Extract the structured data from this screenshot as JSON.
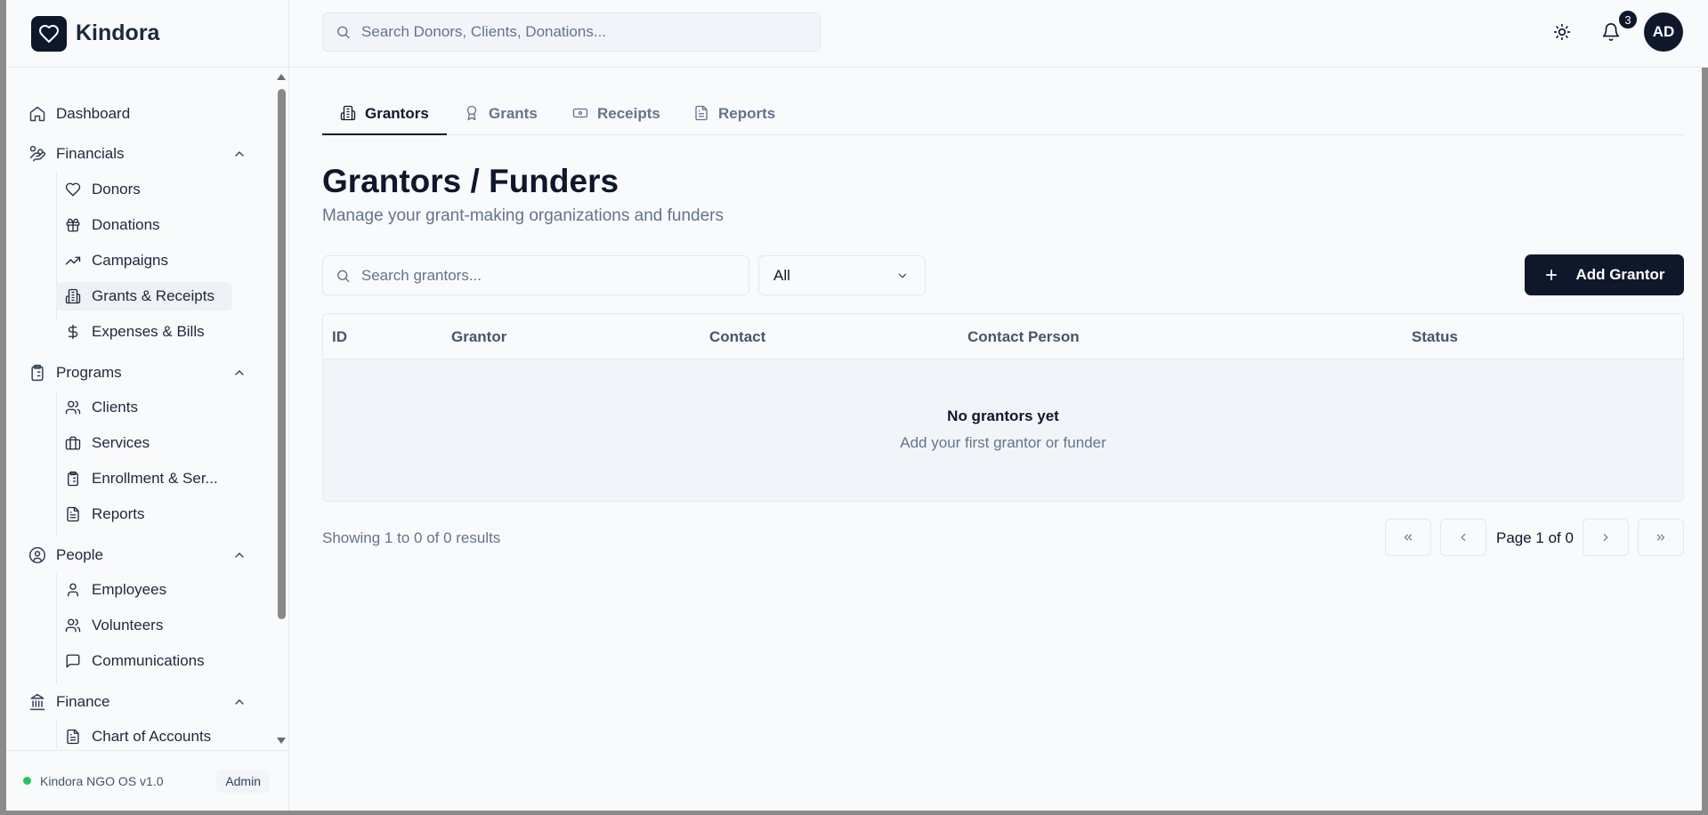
{
  "app": {
    "name": "Kindora"
  },
  "search": {
    "placeholder": "Search Donors, Clients, Donations..."
  },
  "header": {
    "notification_count": "3",
    "avatar_initials": "AD"
  },
  "sidebar": {
    "dashboard": "Dashboard",
    "financials": {
      "label": "Financials",
      "items": [
        "Donors",
        "Donations",
        "Campaigns",
        "Grants & Receipts",
        "Expenses & Bills"
      ]
    },
    "programs": {
      "label": "Programs",
      "items": [
        "Clients",
        "Services",
        "Enrollment & Ser...",
        "Reports"
      ]
    },
    "people": {
      "label": "People",
      "items": [
        "Employees",
        "Volunteers",
        "Communications"
      ]
    },
    "finance": {
      "label": "Finance",
      "items": [
        "Chart of Accounts"
      ]
    },
    "footer": {
      "version": "Kindora NGO OS v1.0",
      "role": "Admin"
    }
  },
  "tabs": [
    "Grantors",
    "Grants",
    "Receipts",
    "Reports"
  ],
  "page": {
    "title": "Grantors / Funders",
    "subtitle": "Manage your grant-making organizations and funders"
  },
  "filters": {
    "search_placeholder": "Search grantors...",
    "status_value": "All",
    "add_label": "Add Grantor"
  },
  "table": {
    "columns": [
      "ID",
      "Grantor",
      "Contact",
      "Contact Person",
      "Status"
    ],
    "empty_title": "No grantors yet",
    "empty_subtitle": "Add your first grantor or funder"
  },
  "pagination": {
    "results_text": "Showing 1 to 0 of 0 results",
    "page_text": "Page 1 of 0"
  },
  "colors": {
    "primary": "#0f172a",
    "status_online": "#22c55e",
    "muted_text": "#64748b"
  }
}
